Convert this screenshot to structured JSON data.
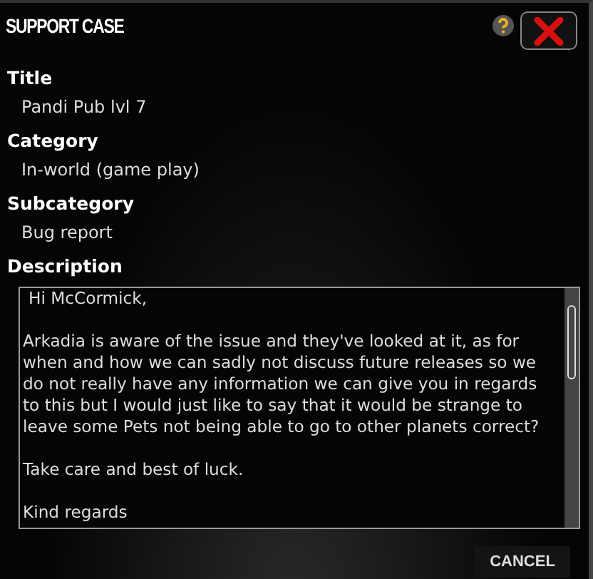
{
  "window": {
    "title": "SUPPORT CASE"
  },
  "fields": [
    {
      "label": "Title",
      "value": "Pandi Pub lvl 7"
    },
    {
      "label": "Category",
      "value": "In-world (game play)"
    },
    {
      "label": "Subcategory",
      "value": "Bug report"
    }
  ],
  "description": {
    "label": "Description",
    "paragraphs": [
      "Hi McCormick,",
      "Arkadia is aware of the issue and they've looked at it, as for when and how we can sadly not discuss future releases so we do not really have any information we can give you in regards to this but I would just like to say that it would be strange to leave some Pets not being able to go to other planets correct?",
      "Take care and best of luck.",
      "Kind regards"
    ]
  },
  "buttons": [
    "CANCEL"
  ]
}
